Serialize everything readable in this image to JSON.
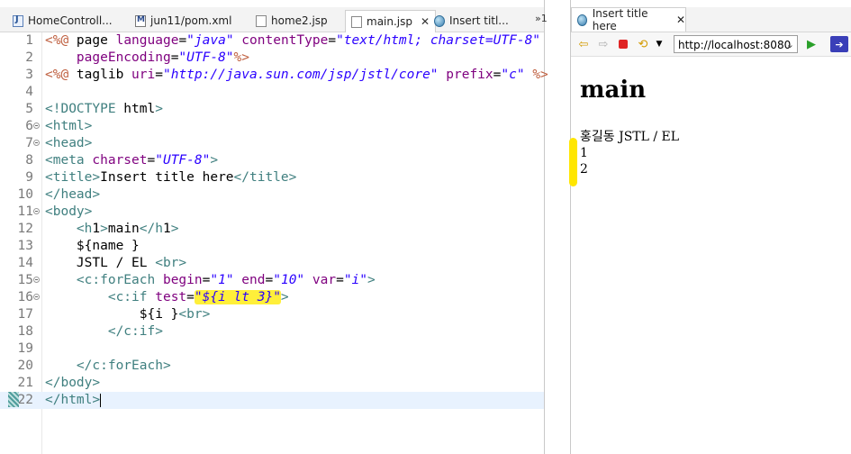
{
  "editor": {
    "tabs": [
      {
        "label": "HomeControll...",
        "icon": "java-file-icon"
      },
      {
        "label": "jun11/pom.xml",
        "icon": "xml-file-icon"
      },
      {
        "label": "home2.jsp",
        "icon": "jsp-file-icon"
      },
      {
        "label": "main.jsp",
        "icon": "jsp-file-icon",
        "active": true
      },
      {
        "label": "Insert titl...",
        "icon": "globe-icon"
      }
    ],
    "overflow_label": "»1",
    "lines": [
      {
        "n": "1",
        "fold": false,
        "text": "<%@ page language=\"java\" contentType=\"text/html; charset=UTF-8\""
      },
      {
        "n": "2",
        "fold": false,
        "text": "    pageEncoding=\"UTF-8\"%>"
      },
      {
        "n": "3",
        "fold": false,
        "text": "<%@ taglib uri=\"http://java.sun.com/jsp/jstl/core\" prefix=\"c\" %>"
      },
      {
        "n": "4",
        "fold": false,
        "text": ""
      },
      {
        "n": "5",
        "fold": false,
        "text": "<!DOCTYPE html>"
      },
      {
        "n": "6",
        "fold": true,
        "text": "<html>"
      },
      {
        "n": "7",
        "fold": true,
        "text": "<head>"
      },
      {
        "n": "8",
        "fold": false,
        "text": "<meta charset=\"UTF-8\">"
      },
      {
        "n": "9",
        "fold": false,
        "text": "<title>Insert title here</title>"
      },
      {
        "n": "10",
        "fold": false,
        "text": "</head>"
      },
      {
        "n": "11",
        "fold": true,
        "text": "<body>"
      },
      {
        "n": "12",
        "fold": false,
        "text": "    <h1>main</h1>"
      },
      {
        "n": "13",
        "fold": false,
        "text": "    ${name }"
      },
      {
        "n": "14",
        "fold": false,
        "text": "    JSTL / EL <br>"
      },
      {
        "n": "15",
        "fold": true,
        "text": "    <c:forEach begin=\"1\" end=\"10\" var=\"i\">"
      },
      {
        "n": "16",
        "fold": true,
        "text": "        <c:if test=\"${i lt 3}\">"
      },
      {
        "n": "17",
        "fold": false,
        "text": "            ${i }<br>"
      },
      {
        "n": "18",
        "fold": false,
        "text": "        </c:if>"
      },
      {
        "n": "19",
        "fold": false,
        "text": ""
      },
      {
        "n": "20",
        "fold": false,
        "text": "    </c:forEach>"
      },
      {
        "n": "21",
        "fold": false,
        "text": "</body>"
      },
      {
        "n": "22",
        "fold": false,
        "text": "</html>"
      }
    ]
  },
  "browser": {
    "tab_label": "Insert title here",
    "url": "http://localhost:8080",
    "page": {
      "heading": "main",
      "lines": [
        "홍길동 JSTL / EL",
        "1",
        "2"
      ]
    }
  }
}
